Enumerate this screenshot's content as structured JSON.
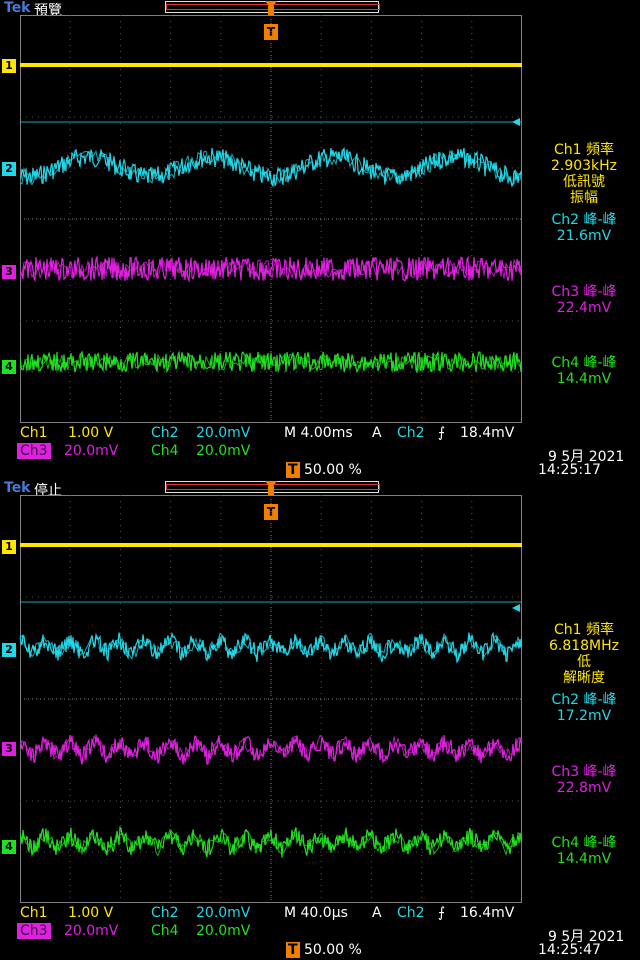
{
  "brand": "Tek",
  "panels": [
    {
      "run_state": "預覽",
      "trigger_marker": "T",
      "channels": [
        {
          "id": "1",
          "color": "#ffe600",
          "wave": "flat"
        },
        {
          "id": "2",
          "color": "#20d8e8",
          "wave": "sine_slow"
        },
        {
          "id": "3",
          "color": "#e020e0",
          "wave": "noise"
        },
        {
          "id": "4",
          "color": "#20e020",
          "wave": "noise"
        }
      ],
      "readouts": {
        "ch1_label": "Ch1 頻率",
        "ch1_val": "2.903kHz",
        "ch1_note1": "低訊號",
        "ch1_note2": "振幅",
        "ch2_label": "Ch2 峰-峰",
        "ch2_val": "21.6mV",
        "ch3_label": "Ch3 峰-峰",
        "ch3_val": "22.4mV",
        "ch4_label": "Ch4 峰-峰",
        "ch4_val": "14.4mV"
      },
      "status": {
        "ch1": "Ch1",
        "ch1_scale": "1.00 V",
        "ch2": "Ch2",
        "ch2_scale": "20.0mV",
        "ch3": "Ch3",
        "ch3_scale": "20.0mV",
        "ch4": "Ch4",
        "ch4_scale": "20.0mV",
        "timebase": "M 4.00ms",
        "mode": "A",
        "trig_src": "Ch2",
        "trig_slope": "⨍",
        "trig_level": "18.4mV",
        "trig_pos_icon": "T",
        "trig_pos": "50.00 %",
        "date": "9 5月  2021",
        "time": "14:25:17"
      }
    },
    {
      "run_state": "停止",
      "trigger_marker": "T",
      "channels": [
        {
          "id": "1",
          "color": "#ffe600",
          "wave": "flat"
        },
        {
          "id": "2",
          "color": "#20d8e8",
          "wave": "zigzag"
        },
        {
          "id": "3",
          "color": "#e020e0",
          "wave": "zigzag"
        },
        {
          "id": "4",
          "color": "#20e020",
          "wave": "zigzag"
        }
      ],
      "readouts": {
        "ch1_label": "Ch1 頻率",
        "ch1_val": "6.818MHz",
        "ch1_note1": "低",
        "ch1_note2": "解晰度",
        "ch2_label": "Ch2 峰-峰",
        "ch2_val": "17.2mV",
        "ch3_label": "Ch3 峰-峰",
        "ch3_val": "22.8mV",
        "ch4_label": "Ch4 峰-峰",
        "ch4_val": "14.4mV"
      },
      "status": {
        "ch1": "Ch1",
        "ch1_scale": "1.00 V",
        "ch2": "Ch2",
        "ch2_scale": "20.0mV",
        "ch3": "Ch3",
        "ch3_scale": "20.0mV",
        "ch4": "Ch4",
        "ch4_scale": "20.0mV",
        "timebase": "M 40.0µs",
        "mode": "A",
        "trig_src": "Ch2",
        "trig_slope": "⨍",
        "trig_level": "16.4mV",
        "trig_pos_icon": "T",
        "trig_pos": "50.00 %",
        "date": "9 5月  2021",
        "time": "14:25:47"
      }
    }
  ]
}
